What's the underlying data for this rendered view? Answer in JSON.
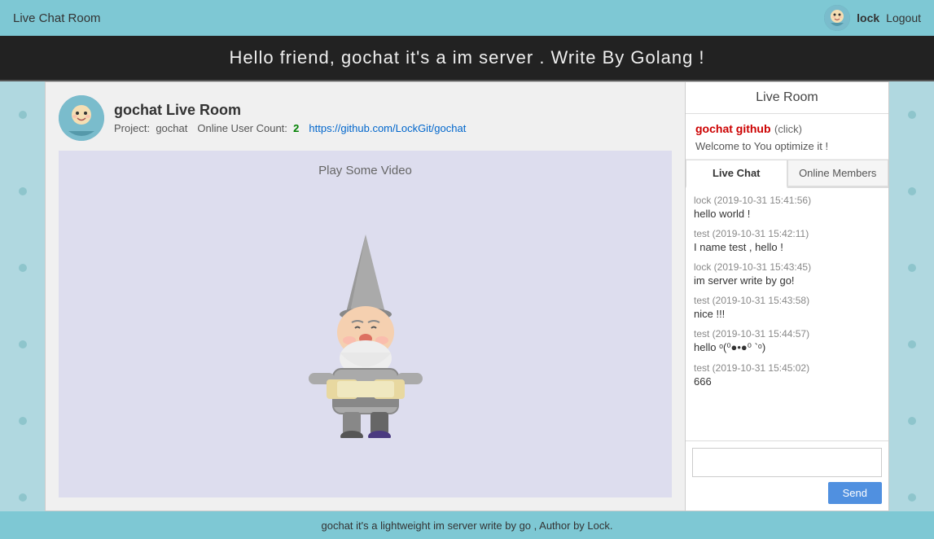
{
  "header": {
    "title": "Live Chat Room",
    "username": "lock",
    "logout_label": "Logout"
  },
  "banner": {
    "text": "Hello friend, gochat it's a im server . Write By Golang !"
  },
  "room": {
    "title": "gochat Live Room",
    "project_label": "Project:",
    "project_name": "gochat",
    "online_label": "Online User Count:",
    "online_count": "2",
    "github_url": "https://github.com/LockGit/gochat",
    "play_video_label": "Play Some Video"
  },
  "right_panel": {
    "title": "Live Room",
    "github_link_text": "gochat github",
    "github_click_text": "(click)",
    "welcome_text": "Welcome to You optimize it !"
  },
  "tabs": {
    "live_chat": "Live Chat",
    "online_members": "Online Members"
  },
  "messages": [
    {
      "meta": "lock (2019-10-31 15:41:56)",
      "text": "hello world !"
    },
    {
      "meta": "test (2019-10-31 15:42:11)",
      "text": "I name test , hello !"
    },
    {
      "meta": "lock (2019-10-31 15:43:45)",
      "text": "im server write by go!"
    },
    {
      "meta": "test (2019-10-31 15:43:58)",
      "text": "nice !!!"
    },
    {
      "meta": "test (2019-10-31 15:44:57)",
      "text": "hello ᵒ(⁰●•●⁰ `ᵒ)"
    },
    {
      "meta": "test (2019-10-31 15:45:02)",
      "text": "666"
    }
  ],
  "chat_input": {
    "placeholder": "",
    "send_label": "Send"
  },
  "footer": {
    "text": "gochat it's a lightweight im server write by go , Author by Lock."
  }
}
